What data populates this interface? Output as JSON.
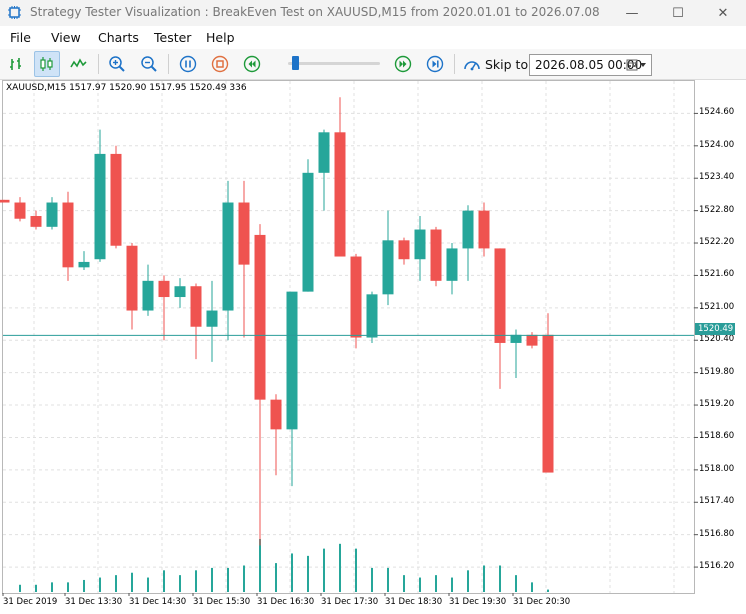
{
  "window": {
    "title": "Strategy Tester Visualization : BreakEven Test on XAUUSD,M15 from 2020.01.01 to 2026.07.08",
    "min_glyph": "—",
    "max_glyph": "☐",
    "close_glyph": "✕"
  },
  "menu": [
    "File",
    "View",
    "Charts",
    "Tester",
    "Help"
  ],
  "toolbar": {
    "icons": [
      "bar-chart-icon",
      "candlestick-icon",
      "line-chart-icon",
      "zoom-in-icon",
      "zoom-out-icon",
      "pause-icon",
      "stop-icon",
      "rewind-icon",
      "fast-forward-icon",
      "next-step-icon"
    ],
    "speed_slider": 0.07,
    "skip_label": "Skip to",
    "skip_date": "2026.08.05 00:00"
  },
  "chart": {
    "symbol_info": "XAUUSD,M15  1517.97  1520.90  1517.95  1520.49  336",
    "current_price_label": "1520.49",
    "colors": {
      "bull": "#26a69a",
      "bear": "#ef5350",
      "price_line": "#2a9d99",
      "grid": "#e0e0e0",
      "volume": "#26a69a"
    }
  },
  "chart_data": {
    "type": "candlestick",
    "price_ticks": [
      "1524.60",
      "1524.00",
      "1523.40",
      "1522.80",
      "1522.20",
      "1521.60",
      "1521.00",
      "1520.40",
      "1519.80",
      "1519.20",
      "1518.60",
      "1518.00",
      "1517.40",
      "1516.80",
      "1516.20"
    ],
    "price_tick_values": [
      1524.6,
      1524.0,
      1523.4,
      1522.8,
      1522.2,
      1521.6,
      1521.0,
      1520.4,
      1519.8,
      1519.2,
      1518.6,
      1518.0,
      1517.4,
      1516.8,
      1516.2
    ],
    "ylim": [
      1515.72,
      1525.2
    ],
    "time_labels": [
      "31 Dec 2019",
      "31 Dec 13:30",
      "31 Dec 14:30",
      "31 Dec 15:30",
      "31 Dec 16:30",
      "31 Dec 17:30",
      "31 Dec 18:30",
      "31 Dec 19:30",
      "31 Dec 20:30"
    ],
    "current_price": 1520.49,
    "candles": [
      {
        "o": 1523.0,
        "h": 1523.0,
        "l": 1522.95,
        "c": 1522.95,
        "v": 0
      },
      {
        "o": 1522.95,
        "h": 1523.05,
        "l": 1522.6,
        "c": 1522.65,
        "v": 3
      },
      {
        "o": 1522.7,
        "h": 1522.8,
        "l": 1522.45,
        "c": 1522.5,
        "v": 3
      },
      {
        "o": 1522.5,
        "h": 1523.05,
        "l": 1522.45,
        "c": 1522.95,
        "v": 4
      },
      {
        "o": 1522.95,
        "h": 1523.15,
        "l": 1521.5,
        "c": 1521.75,
        "v": 4
      },
      {
        "o": 1521.75,
        "h": 1522.05,
        "l": 1521.7,
        "c": 1521.85,
        "v": 5
      },
      {
        "o": 1521.9,
        "h": 1524.3,
        "l": 1521.85,
        "c": 1523.85,
        "v": 6
      },
      {
        "o": 1523.85,
        "h": 1524.0,
        "l": 1522.1,
        "c": 1522.15,
        "v": 7
      },
      {
        "o": 1522.15,
        "h": 1522.2,
        "l": 1520.6,
        "c": 1520.95,
        "v": 8
      },
      {
        "o": 1520.95,
        "h": 1521.8,
        "l": 1520.85,
        "c": 1521.5,
        "v": 6
      },
      {
        "o": 1521.5,
        "h": 1521.6,
        "l": 1520.4,
        "c": 1521.2,
        "v": 9
      },
      {
        "o": 1521.2,
        "h": 1521.55,
        "l": 1521.0,
        "c": 1521.4,
        "v": 7
      },
      {
        "o": 1521.4,
        "h": 1521.45,
        "l": 1520.05,
        "c": 1520.65,
        "v": 9
      },
      {
        "o": 1520.65,
        "h": 1521.5,
        "l": 1520.0,
        "c": 1520.95,
        "v": 10
      },
      {
        "o": 1520.95,
        "h": 1523.35,
        "l": 1520.4,
        "c": 1522.95,
        "v": 10
      },
      {
        "o": 1522.95,
        "h": 1523.35,
        "l": 1520.45,
        "c": 1521.8,
        "v": 11
      },
      {
        "o": 1522.35,
        "h": 1522.55,
        "l": 1516.6,
        "c": 1519.3,
        "v": 22
      },
      {
        "o": 1519.3,
        "h": 1519.4,
        "l": 1517.9,
        "c": 1518.75,
        "v": 12
      },
      {
        "o": 1518.75,
        "h": 1521.15,
        "l": 1517.7,
        "c": 1521.3,
        "v": 16
      },
      {
        "o": 1521.3,
        "h": 1523.75,
        "l": 1521.3,
        "c": 1523.5,
        "v": 15
      },
      {
        "o": 1523.5,
        "h": 1524.3,
        "l": 1522.8,
        "c": 1524.25,
        "v": 18
      },
      {
        "o": 1524.25,
        "h": 1524.9,
        "l": 1521.95,
        "c": 1521.95,
        "v": 20
      },
      {
        "o": 1521.95,
        "h": 1522.0,
        "l": 1520.25,
        "c": 1520.45,
        "v": 18
      },
      {
        "o": 1520.45,
        "h": 1521.3,
        "l": 1520.35,
        "c": 1521.25,
        "v": 10
      },
      {
        "o": 1521.25,
        "h": 1522.8,
        "l": 1521.05,
        "c": 1522.25,
        "v": 10
      },
      {
        "o": 1522.25,
        "h": 1522.3,
        "l": 1521.8,
        "c": 1521.9,
        "v": 7
      },
      {
        "o": 1521.9,
        "h": 1522.7,
        "l": 1521.5,
        "c": 1522.45,
        "v": 6
      },
      {
        "o": 1522.45,
        "h": 1522.5,
        "l": 1521.4,
        "c": 1521.5,
        "v": 7
      },
      {
        "o": 1521.5,
        "h": 1522.2,
        "l": 1521.25,
        "c": 1522.1,
        "v": 6
      },
      {
        "o": 1522.1,
        "h": 1522.9,
        "l": 1521.5,
        "c": 1522.8,
        "v": 9
      },
      {
        "o": 1522.8,
        "h": 1522.95,
        "l": 1521.95,
        "c": 1522.1,
        "v": 11
      },
      {
        "o": 1522.1,
        "h": 1522.1,
        "l": 1519.5,
        "c": 1520.35,
        "v": 11
      },
      {
        "o": 1520.35,
        "h": 1520.6,
        "l": 1519.7,
        "c": 1520.5,
        "v": 7
      },
      {
        "o": 1520.5,
        "h": 1520.55,
        "l": 1520.25,
        "c": 1520.3,
        "v": 4
      },
      {
        "o": 1520.5,
        "h": 1520.9,
        "l": 1517.95,
        "c": 1517.95,
        "v": 1
      }
    ]
  }
}
